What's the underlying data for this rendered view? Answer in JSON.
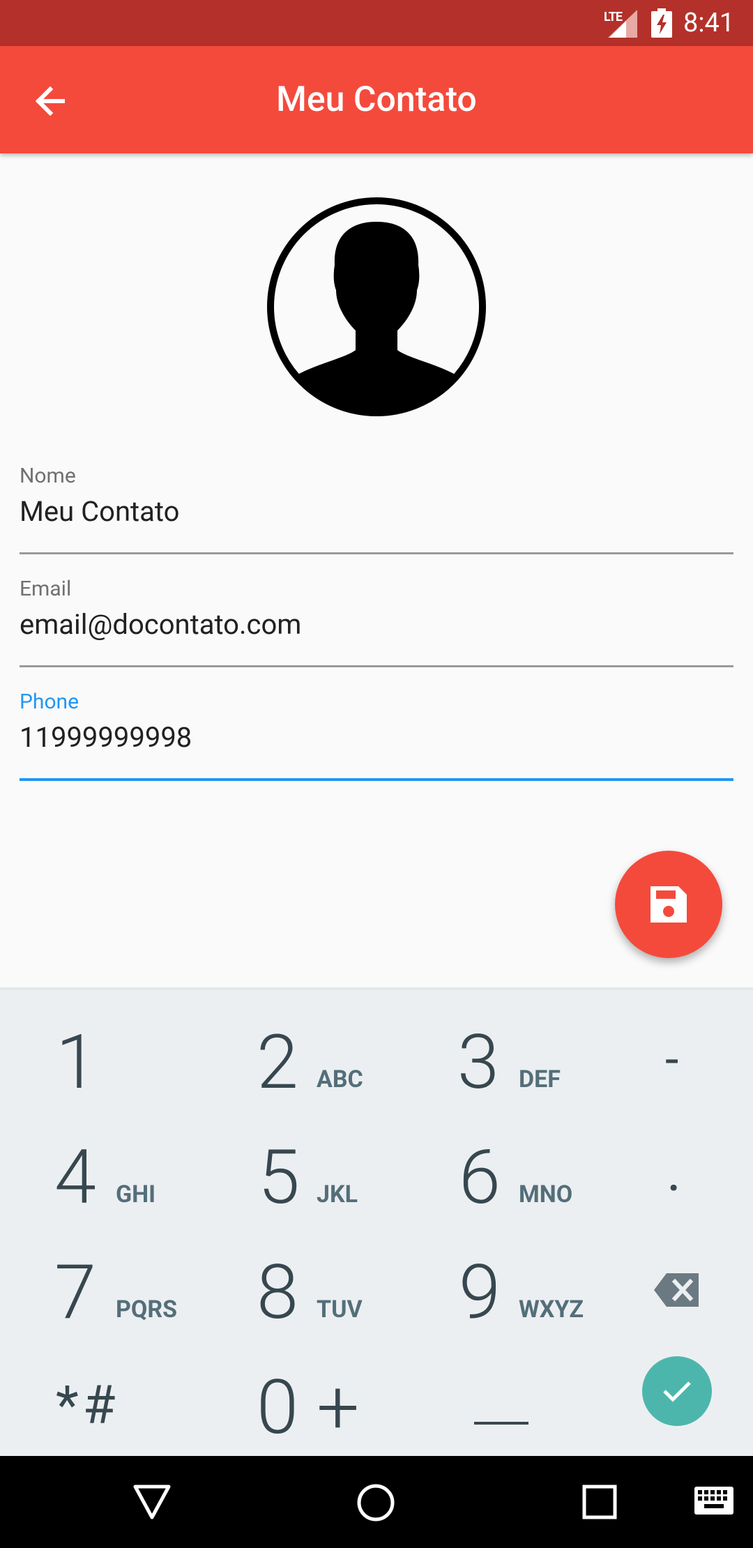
{
  "status_bar": {
    "network": "LTE",
    "time": "8:41"
  },
  "app_bar": {
    "title": "Meu Contato",
    "back_icon": "arrow-left-icon"
  },
  "avatar": {
    "icon": "person-silhouette-icon"
  },
  "form": {
    "name": {
      "label": "Nome",
      "value": "Meu Contato"
    },
    "email": {
      "label": "Email",
      "value": "email@docontato.com"
    },
    "phone": {
      "label": "Phone",
      "value": "11999999998",
      "focused": true
    }
  },
  "fab": {
    "icon": "save-floppy-icon",
    "color": "#f44a3c"
  },
  "keyboard": {
    "keys": [
      {
        "digit": "1",
        "letters": ""
      },
      {
        "digit": "2",
        "letters": "ABC"
      },
      {
        "digit": "3",
        "letters": "DEF"
      },
      {
        "digit": "-",
        "letters": ""
      },
      {
        "digit": "4",
        "letters": "GHI"
      },
      {
        "digit": "5",
        "letters": "JKL"
      },
      {
        "digit": "6",
        "letters": "MNO"
      },
      {
        "digit": ".",
        "letters": ""
      },
      {
        "digit": "7",
        "letters": "PQRS"
      },
      {
        "digit": "8",
        "letters": "TUV"
      },
      {
        "digit": "9",
        "letters": "WXYZ"
      },
      {
        "digit": "*#",
        "letters": ""
      },
      {
        "digit": "0 +",
        "letters": ""
      }
    ],
    "backspace_icon": "backspace-icon",
    "space_icon": "space-bar-icon",
    "done_icon": "checkmark-icon"
  },
  "colors": {
    "status_bar": "#b3312a",
    "app_bar": "#f44a3c",
    "accent": "#2196f3",
    "done_button": "#4db6ac"
  },
  "nav_bar": {
    "back_icon": "nav-back-triangle-icon",
    "home_icon": "nav-home-circle-icon",
    "recents_icon": "nav-recents-square-icon",
    "keyboard_icon": "keyboard-icon"
  }
}
